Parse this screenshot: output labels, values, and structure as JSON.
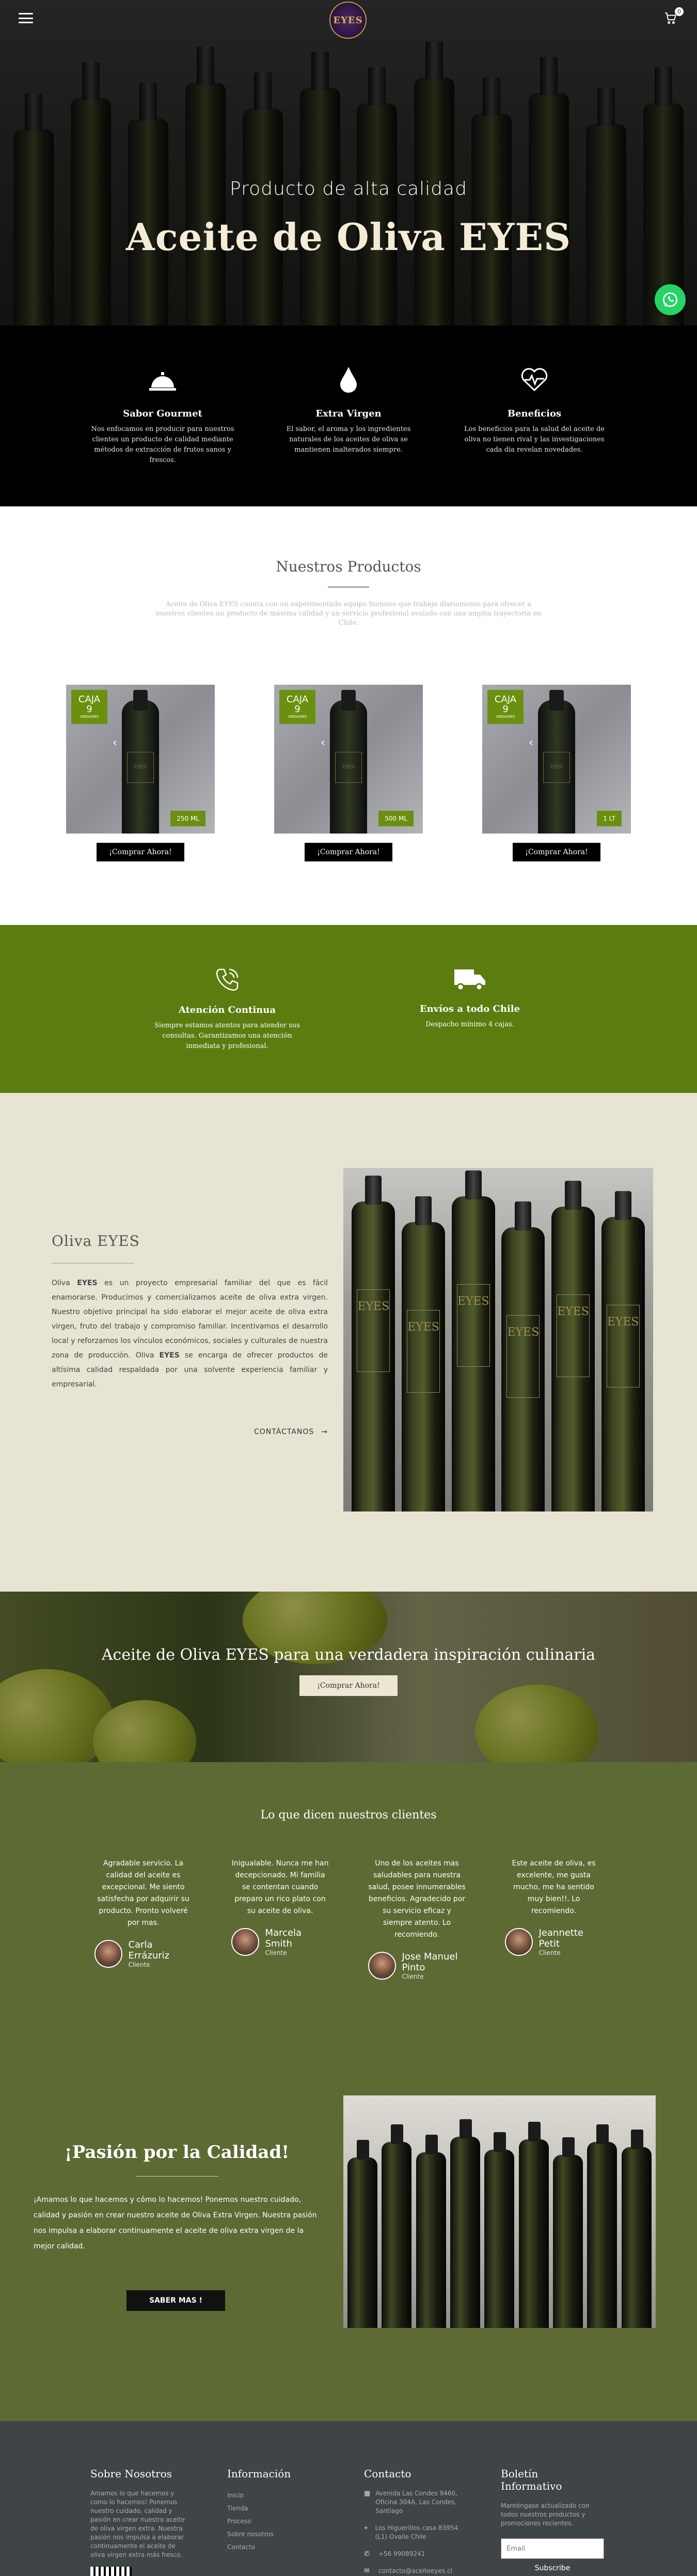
{
  "hero": {
    "logo_text": "EYES",
    "cart_count": "0",
    "subtitle": "Producto de alta calidad",
    "title": "Aceite de Oliva EYES"
  },
  "features": [
    {
      "icon": "service-bell-icon",
      "title": "Sabor Gourmet",
      "text": "Nos enfocamos en producir para nuestros clientes un producto de calidad mediante métodos de extracción de frutos sanos y frescos."
    },
    {
      "icon": "oil-drop-icon",
      "title": "Extra Virgen",
      "text": "El sabor, el aroma y los ingredientes naturales de los aceites de oliva se mantienen inalterados siempre."
    },
    {
      "icon": "heartbeat-icon",
      "title": "Beneficios",
      "text": "Los beneficios para la salud del aceite de oliva no tienen rival y las investigaciones cada día revelan novedades."
    }
  ],
  "products": {
    "title": "Nuestros Productos",
    "intro": "Aceite de Oliva EYES cuenta con un experimentado equipo humano que trabaja diariamente para ofrecer a nuestros clientes un producto de máxima calidad y un servicio profesional avalado con una amplia trayectoria en Chile.",
    "items": [
      {
        "badge_top": "CAJA",
        "badge_qty": "9",
        "badge_unit": "UNIDADES",
        "size": "250 ML",
        "button": "¡Comprar Ahora!"
      },
      {
        "badge_top": "CAJA",
        "badge_qty": "9",
        "badge_unit": "UNIDADES",
        "size": "500 ML",
        "button": "¡Comprar Ahora!"
      },
      {
        "badge_top": "CAJA",
        "badge_qty": "9",
        "badge_unit": "UNIDADES",
        "size": "1 LT",
        "button": "¡Comprar Ahora!"
      }
    ]
  },
  "services": [
    {
      "icon": "phone-icon",
      "title": "Atención Continua",
      "text": "Siempre estamos atentos para atender sus consultas. Garantizamos una atención inmediata y profesional."
    },
    {
      "icon": "truck-icon",
      "title": "Envíos a todo Chile",
      "text": "Despacho mínimo 4 cajas."
    }
  ],
  "about": {
    "title": "Oliva EYES",
    "p1": "Oliva ",
    "brand": "EYES",
    "p2": " es un proyecto empresarial familiar del que es fácil enamorarse. Producimos y comercializamos aceite de oliva extra virgen. Nuestro objetivo principal ha sido elaborar el mejor aceite de oliva extra virgen, fruto del trabajo y compromiso familiar. Incentivamos el desarrollo local y reforzamos los vínculos económicos, sociales y culturales de nuestra zona de producción. Oliva ",
    "p3": " se encarga de ofrecer productos de altísima calidad respaldada por una solvente experiencia familiar y empresarial.",
    "contact": "CONTÁCTANOS",
    "bottle_label": "EYES"
  },
  "banner": {
    "title": "Aceite de Oliva EYES para una verdadera inspiración culinaria",
    "button": "¡Comprar Ahora!"
  },
  "testimonials": {
    "title": "Lo que dicen nuestros clientes",
    "items": [
      {
        "text": "Agradable servicio. La calidad del aceite es excepcional. Me siento satisfecha por adquirir su producto. Pronto volveré por mas.",
        "name": "Carla Errázuriz",
        "role": "Cliente"
      },
      {
        "text": "Inigualable. Nunca me han decepcionado. Mi familia se contentan cuando preparo un rico plato con su aceite de oliva.",
        "name": "Marcela Smith",
        "role": "Cliente"
      },
      {
        "text": "Uno de los aceites mas saludables para nuestra salud, posee innumerables beneficios. Agradecido por su servicio eficaz y siempre atento. Lo recomiendo.",
        "name": "Jose Manuel Pinto",
        "role": "Cliente"
      },
      {
        "text": "Este aceite de oliva, es excelente, me gusta mucho, me ha sentido muy bien!!. Lo recomiendo.",
        "name": "Jeannette Petit",
        "role": "Cliente"
      }
    ]
  },
  "passion": {
    "title": "¡Pasión por la Calidad!",
    "text": "¡Amamos lo que hacemos y cómo lo hacemos! Ponemos nuestro cuidado, calidad y pasión en crear nuestro aceite de Oliva Extra Virgen. Nuestra pasión nos impulsa a elaborar continuamente el aceite de oliva extra virgen de la mejor calidad.",
    "button": "SABER MAS !"
  },
  "footer": {
    "about": {
      "title": "Sobre Nosotros",
      "text": "Amamos lo que hacemos y como lo hacemos! Ponemos nuestro cuidado, calidad y pasión en crear nuestro aceite de oliva virgen extra. Nuestra pasión nos impulsa a elaborar continuamente el aceite de oliva virgen extra más fresco."
    },
    "info": {
      "title": "Información",
      "links": [
        "Inicio",
        "Tienda",
        "Proceso",
        "Sobre nosotros",
        "Contacto"
      ]
    },
    "contact": {
      "title": "Contacto",
      "address1": "Avenida Las Condes 9460, Oficina 304A, Las Condes, Santiago",
      "address2": "Los Higuerillos casa 83954 (L1) Ovalle Chile",
      "phone": "+56 99089241",
      "email": "contacto@aceiteeyes.cl"
    },
    "news": {
      "title": "Boletín Informativo",
      "text": "Manténgase actualizado con todos nuestros productos y promociones recientes.",
      "placeholder": "Email",
      "button": "Subscribe"
    }
  }
}
